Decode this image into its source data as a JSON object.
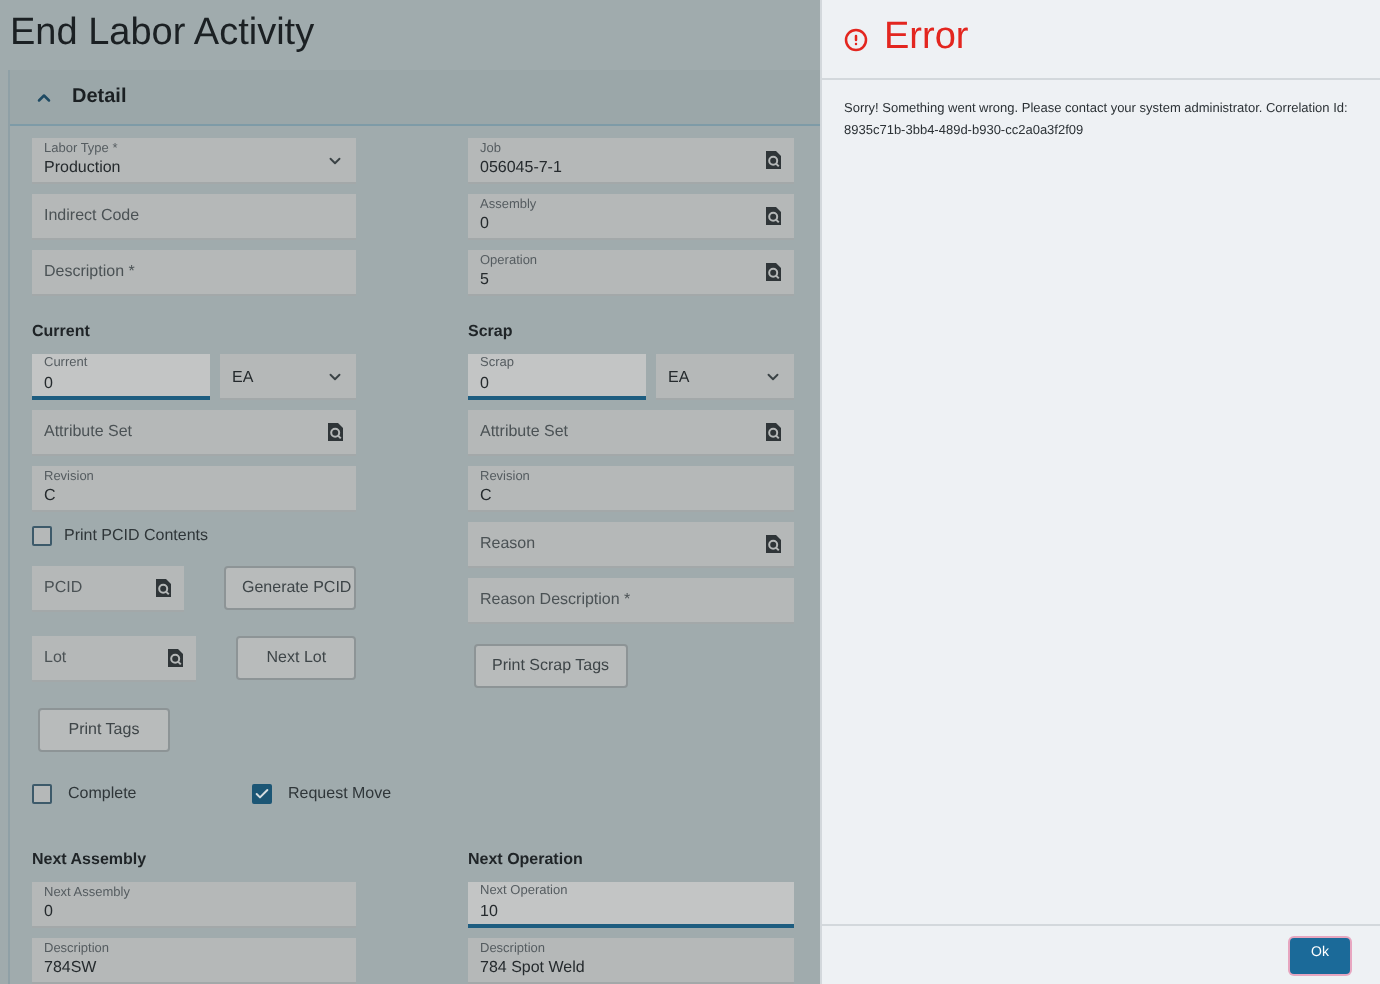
{
  "page": {
    "title": "End Labor Activity"
  },
  "detail": {
    "title": "Detail",
    "expanded": true,
    "columns": [
      [
        {
          "kind": "select",
          "label": "Labor Type *",
          "value": "Production"
        },
        {
          "kind": "text",
          "placeholder": "Indirect Code"
        },
        {
          "kind": "text",
          "placeholder": "Description *"
        },
        {
          "kind": "heading",
          "text": "Current"
        },
        {
          "kind": "quantity",
          "input": {
            "label": "Current",
            "value": "0",
            "focused": true
          },
          "unit": {
            "value": "EA"
          }
        },
        {
          "kind": "lookup",
          "placeholder": "Attribute Set"
        },
        {
          "kind": "text",
          "label": "Revision",
          "value": "C"
        },
        {
          "kind": "checkbox",
          "label": "Print PCID Contents",
          "checked": false
        },
        {
          "kind": "lookup_action",
          "field": {
            "placeholder": "PCID"
          },
          "button": "Generate PCID"
        },
        {
          "kind": "lookup_action",
          "field": {
            "placeholder": "Lot"
          },
          "button": "Next Lot"
        },
        {
          "kind": "button",
          "text": "Print Tags"
        }
      ],
      [
        {
          "kind": "lookup",
          "label": "Job",
          "value": "056045-7-1"
        },
        {
          "kind": "lookup",
          "label": "Assembly",
          "value": "0"
        },
        {
          "kind": "lookup",
          "label": "Operation",
          "value": "5"
        },
        {
          "kind": "heading",
          "text": "Scrap"
        },
        {
          "kind": "quantity",
          "input": {
            "label": "Scrap",
            "value": "0",
            "focused": true
          },
          "unit": {
            "value": "EA"
          }
        },
        {
          "kind": "lookup",
          "placeholder": "Attribute Set"
        },
        {
          "kind": "text",
          "label": "Revision",
          "value": "C"
        },
        {
          "kind": "lookup",
          "placeholder": "Reason"
        },
        {
          "kind": "text",
          "placeholder": "Reason Description *"
        },
        {
          "kind": "button",
          "text": "Print Scrap Tags"
        }
      ]
    ],
    "checkboxes": [
      {
        "label": "Complete",
        "checked": false
      },
      {
        "label": "Request Move",
        "checked": true
      }
    ],
    "next_sections": [
      [
        {
          "kind": "heading",
          "text": "Next Assembly"
        },
        {
          "kind": "text",
          "label": "Next Assembly",
          "value": "0"
        },
        {
          "kind": "text",
          "label": "Description",
          "value": "784SW"
        }
      ],
      [
        {
          "kind": "heading",
          "text": "Next Operation"
        },
        {
          "kind": "text",
          "label": "Next Operation",
          "value": "10",
          "focused": true
        },
        {
          "kind": "text",
          "label": "Description",
          "value": "784 Spot Weld"
        }
      ]
    ]
  },
  "error_panel": {
    "title": "Error",
    "message": "Sorry! Something went wrong. Please contact your system administrator. Correlation Id: 8935c71b-3bb4-489d-b930-cc2a0a3f2f09",
    "buttons": [
      "Ok"
    ]
  }
}
